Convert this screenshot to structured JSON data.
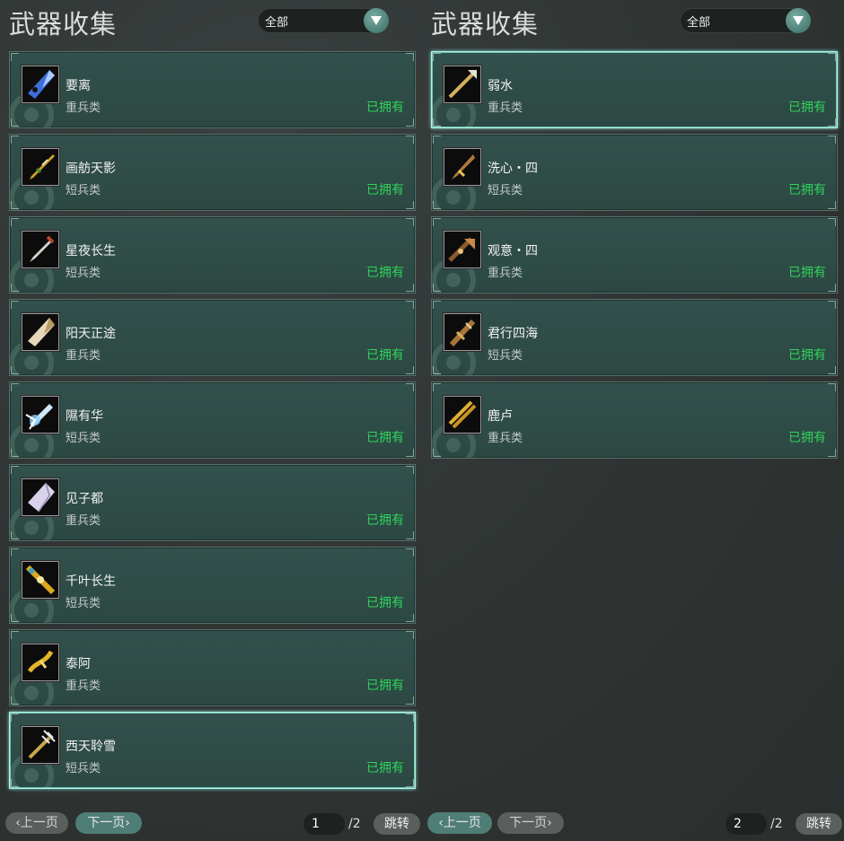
{
  "left_panel": {
    "title": "武器收集",
    "filter": {
      "selected": "全部",
      "dropdown_icon": "chevron-down-icon"
    },
    "weapons": [
      {
        "name": "要离",
        "type": "重兵类",
        "status": "已拥有"
      },
      {
        "name": "画舫天影",
        "type": "短兵类",
        "status": "已拥有"
      },
      {
        "name": "星夜长生",
        "type": "短兵类",
        "status": "已拥有"
      },
      {
        "name": "阳天正途",
        "type": "重兵类",
        "status": "已拥有"
      },
      {
        "name": "隰有华",
        "type": "短兵类",
        "status": "已拥有"
      },
      {
        "name": "见子都",
        "type": "重兵类",
        "status": "已拥有"
      },
      {
        "name": "千叶长生",
        "type": "短兵类",
        "status": "已拥有"
      },
      {
        "name": "泰阿",
        "type": "重兵类",
        "status": "已拥有"
      },
      {
        "name": "西天聆雪",
        "type": "短兵类",
        "status": "已拥有"
      }
    ],
    "pager": {
      "prev": "上一页",
      "next": "下一页",
      "current_page": "1",
      "total": "/2",
      "jump": "跳转"
    }
  },
  "right_panel": {
    "title": "武器收集",
    "filter": {
      "selected": "全部",
      "dropdown_icon": "chevron-down-icon"
    },
    "weapons": [
      {
        "name": "弱水",
        "type": "重兵类",
        "status": "已拥有"
      },
      {
        "name": "洗心・四",
        "type": "短兵类",
        "status": "已拥有"
      },
      {
        "name": "观意・四",
        "type": "重兵类",
        "status": "已拥有"
      },
      {
        "name": "君行四海",
        "type": "短兵类",
        "status": "已拥有"
      },
      {
        "name": "鹿卢",
        "type": "重兵类",
        "status": "已拥有"
      }
    ],
    "pager": {
      "prev": "上一页",
      "next": "下一页",
      "current_page": "2",
      "total": "/2",
      "jump": "跳转"
    }
  },
  "colors": {
    "owned_green": "#2ed45a",
    "card_bg": "#2f4d48",
    "selected_border": "#b8f0e6"
  }
}
